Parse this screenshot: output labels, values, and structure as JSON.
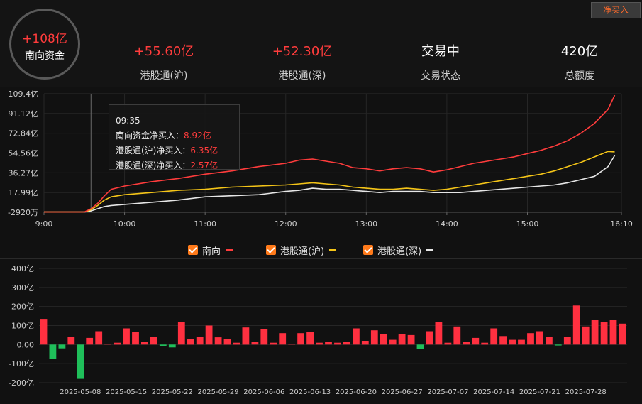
{
  "header": {
    "total_label": "南向资金",
    "total_value": "+108亿",
    "button_label": "净买入",
    "stats": [
      {
        "value": "+55.60亿",
        "label": "港股通(沪)",
        "color": "#ff3c3c"
      },
      {
        "value": "+52.30亿",
        "label": "港股通(深)",
        "color": "#ff3c3c"
      },
      {
        "value": "交易中",
        "label": "交易状态",
        "color": "#ffffff"
      },
      {
        "value": "420亿",
        "label": "总额度",
        "color": "#ffffff"
      }
    ]
  },
  "tooltip": {
    "time": "09:35",
    "rows": [
      {
        "label": "南向资金净买入：",
        "value": "8.92亿"
      },
      {
        "label": "港股通(沪)净买入：",
        "value": "6.35亿"
      },
      {
        "label": "港股通(深)净买入：",
        "value": "2.57亿"
      }
    ]
  },
  "legend": [
    {
      "label": "南向",
      "color": "#ff3c3c"
    },
    {
      "label": "港股通(沪)",
      "color": "#f5c518"
    },
    {
      "label": "港股通(深)",
      "color": "#e6e6e6"
    }
  ],
  "chart_data": [
    {
      "type": "line",
      "y_tick_labels": [
        "109.4亿",
        "91.12亿",
        "72.84亿",
        "54.56亿",
        "36.27亿",
        "17.99亿",
        "-2920万"
      ],
      "y_tick_values": [
        109.4,
        91.12,
        72.84,
        54.56,
        36.27,
        17.99,
        -0.292
      ],
      "ylim": [
        -0.292,
        109.4
      ],
      "x_tick_labels": [
        "9:00",
        "10:00",
        "11:00",
        "12:00",
        "13:00",
        "14:00",
        "15:00",
        "16:10"
      ],
      "x_tick_minutes": [
        540,
        600,
        660,
        720,
        780,
        840,
        900,
        970
      ],
      "xlim": [
        540,
        970
      ],
      "grid": true,
      "series": [
        {
          "name": "南向",
          "color": "#ff3c3c",
          "x": [
            540,
            570,
            575,
            580,
            585,
            590,
            600,
            620,
            640,
            660,
            680,
            700,
            720,
            730,
            740,
            750,
            760,
            770,
            780,
            790,
            800,
            810,
            820,
            830,
            840,
            850,
            860,
            870,
            880,
            890,
            900,
            910,
            920,
            930,
            940,
            950,
            960,
            965
          ],
          "y": [
            0,
            0,
            3,
            8,
            15,
            21,
            24,
            28,
            31,
            35,
            38,
            42,
            45,
            48,
            49,
            47,
            45,
            41,
            40,
            38,
            40,
            41,
            40,
            37,
            39,
            42,
            45,
            47,
            49,
            51,
            54,
            57,
            61,
            66,
            73,
            82,
            95,
            108
          ]
        },
        {
          "name": "港股通(沪)",
          "color": "#f5c518",
          "x": [
            540,
            570,
            575,
            580,
            585,
            590,
            600,
            620,
            640,
            660,
            680,
            700,
            720,
            730,
            740,
            750,
            760,
            770,
            780,
            790,
            800,
            810,
            820,
            830,
            840,
            850,
            860,
            870,
            880,
            890,
            900,
            910,
            920,
            930,
            940,
            950,
            960,
            965
          ],
          "y": [
            0,
            0,
            2,
            6,
            11,
            14,
            16,
            18,
            20,
            21,
            23,
            24,
            25,
            26,
            27,
            26,
            25,
            23,
            22,
            21,
            21,
            22,
            21,
            20,
            21,
            23,
            25,
            27,
            29,
            31,
            33,
            35,
            38,
            42,
            46,
            51,
            56,
            55.6
          ]
        },
        {
          "name": "港股通(深)",
          "color": "#e6e6e6",
          "x": [
            540,
            570,
            575,
            580,
            585,
            590,
            600,
            620,
            640,
            660,
            680,
            700,
            720,
            730,
            740,
            750,
            760,
            770,
            780,
            790,
            800,
            810,
            820,
            830,
            840,
            850,
            860,
            870,
            880,
            890,
            900,
            910,
            920,
            930,
            940,
            950,
            960,
            965
          ],
          "y": [
            0,
            0,
            1,
            3,
            5,
            6,
            7,
            9,
            11,
            14,
            15,
            16,
            19,
            20,
            22,
            21,
            21,
            20,
            19,
            18,
            19,
            19,
            19,
            18,
            18,
            18,
            19,
            20,
            21,
            22,
            23,
            24,
            25,
            27,
            30,
            33,
            42,
            52.3
          ]
        }
      ]
    },
    {
      "type": "bar",
      "y_tick_labels": [
        "400亿",
        "300亿",
        "200亿",
        "100亿",
        "0.00",
        "-100亿",
        "-200亿"
      ],
      "y_tick_values": [
        400,
        300,
        200,
        100,
        0,
        -100,
        -200
      ],
      "ylim": [
        -200,
        400
      ],
      "grid": true,
      "x_tick_labels": [
        "2025-05-08",
        "2025-05-15",
        "2025-05-22",
        "2025-05-29",
        "2025-06-06",
        "2025-06-13",
        "2025-06-20",
        "2025-06-27",
        "2025-07-07",
        "2025-07-14",
        "2025-07-21",
        "2025-07-28"
      ],
      "x_tick_bar_index": [
        4,
        9,
        14,
        19,
        24,
        29,
        34,
        39,
        44,
        49,
        54,
        59
      ],
      "colors": {
        "positive": "#ff3040",
        "negative": "#1fbf5a"
      },
      "values": [
        135,
        -75,
        -20,
        40,
        -180,
        35,
        70,
        5,
        10,
        85,
        65,
        15,
        40,
        -10,
        -15,
        120,
        30,
        40,
        100,
        38,
        30,
        10,
        90,
        15,
        80,
        10,
        60,
        5,
        60,
        65,
        10,
        15,
        10,
        15,
        85,
        20,
        75,
        55,
        25,
        55,
        50,
        -25,
        70,
        120,
        10,
        95,
        15,
        35,
        10,
        85,
        45,
        25,
        25,
        60,
        70,
        40,
        -5,
        40,
        205,
        95,
        130,
        120,
        130,
        110
      ]
    }
  ]
}
